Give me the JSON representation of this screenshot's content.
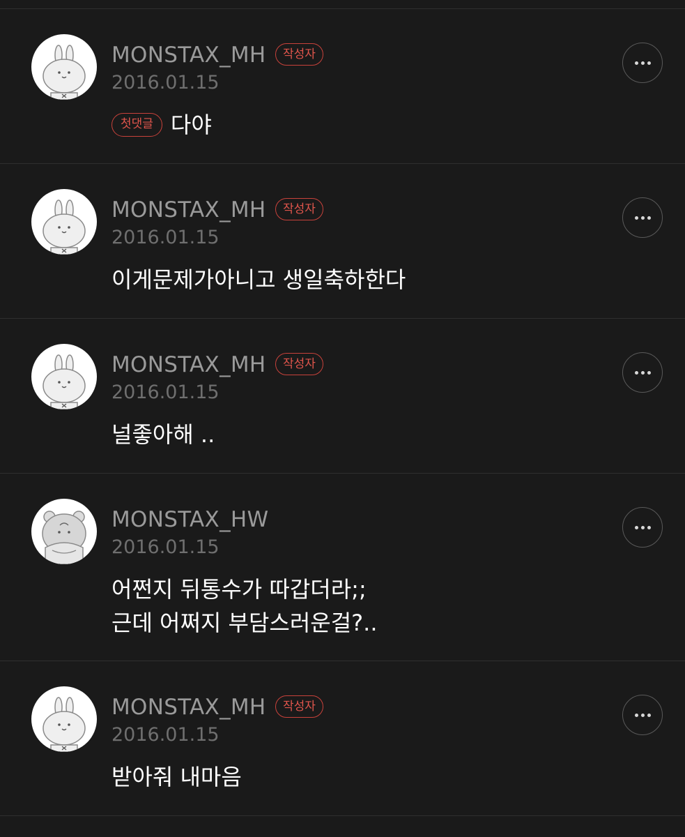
{
  "comments": [
    {
      "username": "MONSTAX_MH",
      "author_badge": "작성자",
      "date": "2016.01.15",
      "first_badge": "첫댓글",
      "text": "다야",
      "avatar": "rabbit-avatar"
    },
    {
      "username": "MONSTAX_MH",
      "author_badge": "작성자",
      "date": "2016.01.15",
      "text": "이게문제가아니고 생일축하한다",
      "avatar": "rabbit-avatar"
    },
    {
      "username": "MONSTAX_MH",
      "author_badge": "작성자",
      "date": "2016.01.15",
      "text": "널좋아해 ..",
      "avatar": "rabbit-avatar"
    },
    {
      "username": "MONSTAX_HW",
      "date": "2016.01.15",
      "text": "어쩐지 뒤통수가 따갑더라;;\n근데 어쩌지 부담스러운걸?..",
      "avatar": "bear-avatar"
    },
    {
      "username": "MONSTAX_MH",
      "author_badge": "작성자",
      "date": "2016.01.15",
      "text": "받아줘 내마음",
      "avatar": "rabbit-avatar"
    }
  ],
  "icons": {
    "more": "more-options-icon"
  },
  "colors": {
    "background": "#1a1a1a",
    "divider": "#2f2f2f",
    "badge_red": "#e0554c",
    "username_gray": "#9a9a9a",
    "date_gray": "#6f6f6f"
  }
}
